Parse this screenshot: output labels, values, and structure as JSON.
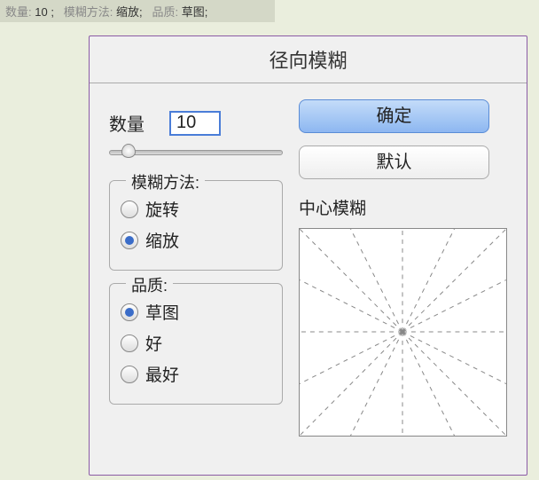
{
  "topInfo": {
    "amountKey": "数量:",
    "amountVal": "10 ;",
    "methodKey": "模糊方法:",
    "methodVal": "缩放;",
    "qualityKey": "品质:",
    "qualityVal": "草图;"
  },
  "dialog": {
    "title": "径向模糊",
    "amount": {
      "label": "数量",
      "value": "10"
    },
    "blurMethod": {
      "legend": "模糊方法:",
      "options": [
        {
          "label": "旋转",
          "checked": false
        },
        {
          "label": "缩放",
          "checked": true
        }
      ]
    },
    "quality": {
      "legend": "品质:",
      "options": [
        {
          "label": "草图",
          "checked": true
        },
        {
          "label": "好",
          "checked": false
        },
        {
          "label": "最好",
          "checked": false
        }
      ]
    },
    "buttons": {
      "ok": "确定",
      "default": "默认"
    },
    "preview": {
      "label": "中心模糊"
    }
  }
}
